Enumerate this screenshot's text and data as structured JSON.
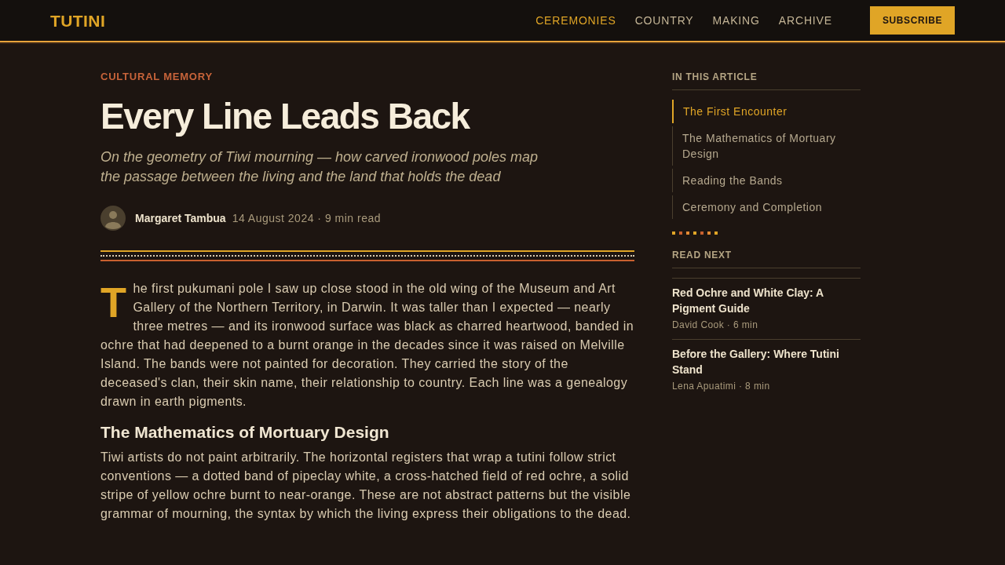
{
  "header": {
    "logo": "TUTINI",
    "nav": [
      {
        "label": "CEREMONIES",
        "selected": true
      },
      {
        "label": "COUNTRY",
        "selected": false
      },
      {
        "label": "MAKING",
        "selected": false
      },
      {
        "label": "ARCHIVE",
        "selected": false
      }
    ],
    "subscribe_button": "SUBSCRIBE"
  },
  "article": {
    "category": "CULTURAL MEMORY",
    "title": "Every Line Leads Back",
    "subtitle": "On the geometry of Tiwi mourning — how carved ironwood poles map the passage between the living and the land that holds the dead",
    "author": {
      "name": "Margaret Tambua",
      "meta": "14 August 2024 · 9 min read"
    },
    "blocks": [
      {
        "kind": "lead",
        "text": "The first pukumani pole I saw up close stood in the old wing of the Museum and Art Gallery of the Northern Territory, in Darwin. It was taller than I expected — nearly three metres — and its ironwood surface was black as charred heartwood, banded in ochre that had deepened to a burnt orange in the decades since it was raised on Melville Island. The bands were not painted for decoration. They carried the story of the deceased's clan, their skin name, their relationship to country. Each line was a genealogy drawn in earth pigments."
      },
      {
        "kind": "heading",
        "text": "The Mathematics of Mortuary Design"
      },
      {
        "kind": "paragraph",
        "text": "Tiwi artists do not paint arbitrarily. The horizontal registers that wrap a tutini follow strict conventions — a dotted band of pipeclay white, a cross-hatched field of red ochre, a solid stripe of yellow ochre burnt to near-orange. These are not abstract patterns but the visible grammar of mourning, the syntax by which the living express their obligations to the dead."
      }
    ]
  },
  "sidebar": {
    "toc": {
      "title": "IN THIS ARTICLE",
      "items": [
        {
          "label": "The First Encounter",
          "selected": true
        },
        {
          "label": "The Mathematics of Mortuary Design",
          "selected": false
        },
        {
          "label": "Reading the Bands",
          "selected": false
        },
        {
          "label": "Ceremony and Completion",
          "selected": false
        }
      ]
    },
    "read_next": {
      "title": "READ NEXT",
      "items": [
        {
          "title": "Red Ochre and White Clay: A Pigment Guide",
          "meta": "David Cook · 6 min"
        },
        {
          "title": "Before the Gallery: Where Tutini Stand",
          "meta": "Lena Apuatimi · 8 min"
        }
      ]
    }
  }
}
